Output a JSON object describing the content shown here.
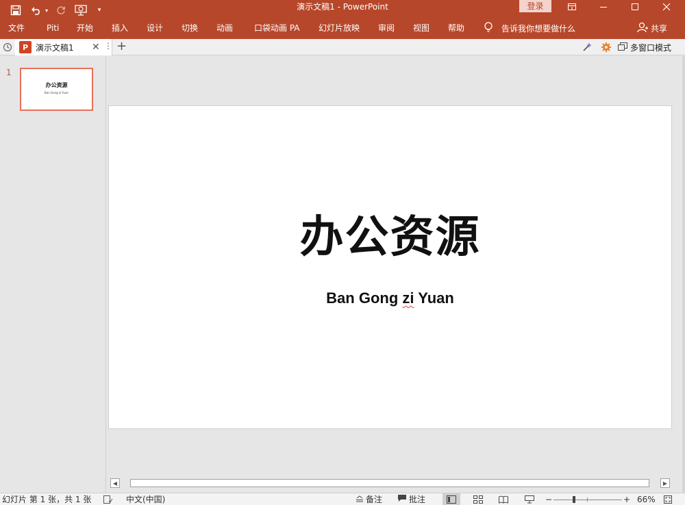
{
  "window": {
    "title": "演示文稿1  -  PowerPoint",
    "login_label": "登录"
  },
  "quick_access": {
    "save_icon": "save-icon",
    "undo_icon": "undo-icon",
    "redo_icon": "redo-icon",
    "start_from_beginning_icon": "slideshow-start-icon",
    "customize_icon": "customize-qat-icon"
  },
  "ribbon_tabs": [
    "文件",
    "Piti",
    "开始",
    "插入",
    "设计",
    "切换",
    "动画",
    "口袋动画 PA",
    "幻灯片放映",
    "审阅",
    "视图",
    "帮助"
  ],
  "tell_me": "告诉我你想要做什么",
  "share_label": "共享",
  "document_tab": {
    "app_badge": "P",
    "label": "演示文稿1",
    "more_icon": "more-vertical-icon",
    "multi_window_label": "多窗口模式"
  },
  "thumbnails": [
    {
      "number": "1",
      "title": "办公资源",
      "subtitle": "Ban Gong zi Yuan"
    }
  ],
  "slide": {
    "title": "办公资源",
    "subtitle_before": "Ban Gong ",
    "subtitle_misspelled": "zi",
    "subtitle_after": " Yuan"
  },
  "status_bar": {
    "slide_info": "幻灯片 第 1 张，共 1 张",
    "language": "中文(中国)",
    "notes_label": "备注",
    "comments_label": "批注",
    "zoom_minus": "−",
    "zoom_plus": "+",
    "zoom_level": "66%"
  },
  "colors": {
    "accent": "#b7472a",
    "thumb_border": "#e8705a"
  }
}
